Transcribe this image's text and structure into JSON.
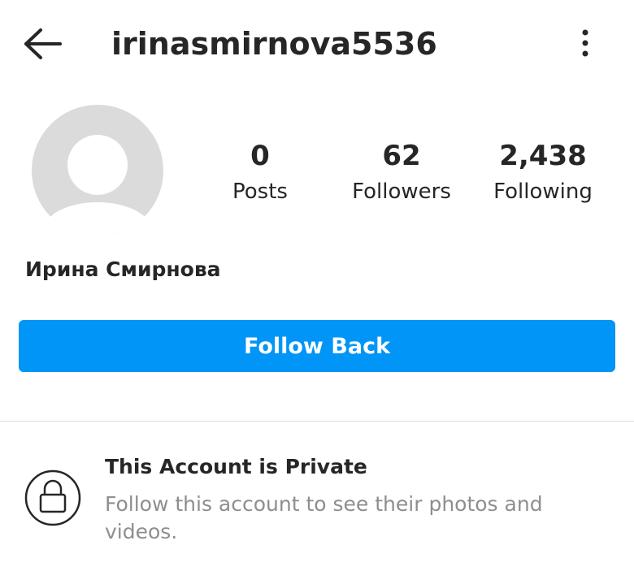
{
  "header": {
    "username": "irinasmirnova5536"
  },
  "profile": {
    "full_name": "Ирина Смирнова",
    "stats": [
      {
        "value": "0",
        "label": "Posts"
      },
      {
        "value": "62",
        "label": "Followers"
      },
      {
        "value": "2,438",
        "label": "Following"
      }
    ]
  },
  "actions": {
    "follow_back_label": "Follow Back"
  },
  "private_notice": {
    "title": "This Account is Private",
    "description": "Follow this account to see their photos and videos."
  },
  "icons": {
    "back": "arrow-left-icon",
    "more": "more-vertical-icon",
    "lock": "lock-icon",
    "avatar": "default-avatar"
  },
  "colors": {
    "accent": "#0095f6",
    "text": "#262626",
    "muted": "#8e8e8e",
    "avatar_bg": "#dbdbdb",
    "divider": "#dbdbdb"
  }
}
